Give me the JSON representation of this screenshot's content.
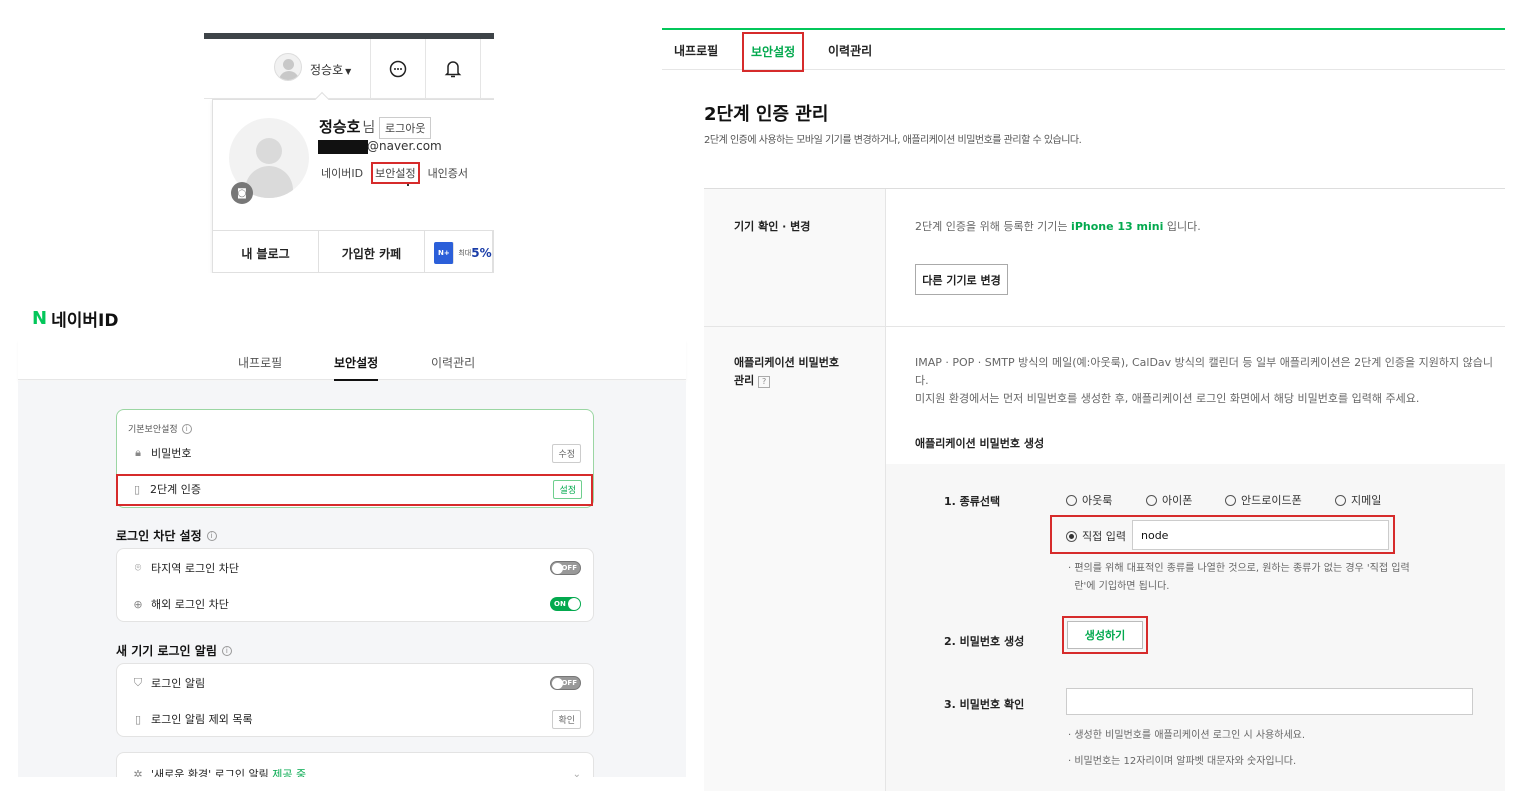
{
  "naver_menu": {
    "header_name": "정승호",
    "profile_name": "정승호",
    "honorific": "님",
    "logout": "로그아웃",
    "email_suffix": "@naver.com",
    "links": [
      "네이버ID",
      "보안설정",
      "내인증서"
    ],
    "bottom_buttons": [
      "내 블로그",
      "가입한 카페"
    ],
    "promo_badge": "N+",
    "promo_sub": "최대",
    "promo_value": "5%"
  },
  "naver_id": {
    "logo_n": "N",
    "logo_text": "네이버ID",
    "tabs": [
      "내프로필",
      "보안설정",
      "이력관리"
    ],
    "basic_section": "기본보안설정",
    "password": {
      "label": "비밀번호",
      "button": "수정"
    },
    "two_step": {
      "label": "2단계 인증",
      "button": "설정"
    },
    "block_section": "로그인 차단 설정",
    "foreign_region_block": {
      "label": "타지역 로그인 차단",
      "state": "OFF"
    },
    "overseas_block": {
      "label": "해외 로그인 차단",
      "state": "ON"
    },
    "new_device_section": "새 기기 로그인 알림",
    "login_alert": {
      "label": "로그인 알림",
      "state": "OFF"
    },
    "alert_exclusion": {
      "label": "로그인 알림 제외 목록",
      "button": "확인"
    },
    "new_env_alert": {
      "label": "'새로운 환경' 로그인 알림",
      "status": "제공 중"
    }
  },
  "two_step_page": {
    "tabs": [
      "내프로필",
      "보안설정",
      "이력관리"
    ],
    "title": "2단계 인증 관리",
    "subtitle": "2단계 인증에 사용하는 모바일 기기를 변경하거나, 애플리케이션 비밀번호를 관리할 수 있습니다.",
    "device": {
      "label": "기기 확인 · 변경",
      "text_before": "2단계 인증을 위해 등록한 기기는",
      "device_name": "iPhone 13 mini",
      "text_after": "입니다.",
      "button": "다른 기기로 변경"
    },
    "app_password": {
      "label_line1": "애플리케이션 비밀번호",
      "label_line2": "관리",
      "help": "?",
      "desc1": "IMAP · POP · SMTP 방식의 메일(예:아웃룩), CalDav 방식의 캘린더 등 일부 애플리케이션은 2단계 인증을 지원하지 않습니",
      "desc1b": "다.",
      "desc2": "미지원 환경에서는 먼저 비밀번호를 생성한 후, 애플리케이션 로그인 화면에서 해당 비밀번호를 입력해 주세요.",
      "gen_title": "애플리케이션 비밀번호 생성",
      "step1": "1. 종류선택",
      "types": [
        "아웃룩",
        "아이폰",
        "안드로이드폰",
        "지메일"
      ],
      "direct_label": "직접 입력",
      "direct_value": "node",
      "note1": "· 편의를 위해 대표적인 종류를 나열한 것으로, 원하는 종류가 없는 경우 '직접 입력",
      "note1b": "란'에 기입하면 됩니다.",
      "step2": "2. 비밀번호 생성",
      "gen_button": "생성하기",
      "step3": "3. 비밀번호 확인",
      "confirm_value": "",
      "tip1": "· 생성한 비밀번호를 애플리케이션 로그인 시 사용하세요.",
      "tip2": "· 비밀번호는 12자리이며 알파벳 대문자와 숫자입니다."
    }
  },
  "colors": {
    "naver_green": "#03c75a",
    "accent_green": "#03a94e",
    "highlight_red": "#d62b2b"
  }
}
